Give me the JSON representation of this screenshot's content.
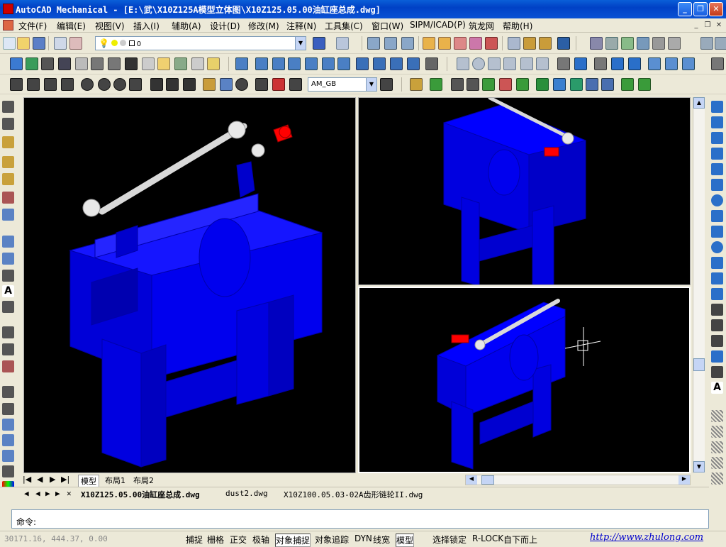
{
  "window": {
    "title": "AutoCAD Mechanical - [E:\\武\\X10Z125A模型立体图\\X10Z125.05.00油缸座总成.dwg]"
  },
  "menu": [
    "文件(F)",
    "编辑(E)",
    "视图(V)",
    "插入(I)",
    "辅助(A)",
    "设计(D)",
    "修改(M)",
    "注释(N)",
    "工具集(C)",
    "窗口(W)",
    "SIPM/ICAD(P)",
    "筑龙网",
    "帮助(H)"
  ],
  "toolbar": {
    "layer_value": "0",
    "dimstyle_value": "AM_GB"
  },
  "layout_tabs": [
    "模型",
    "布局1",
    "布局2"
  ],
  "doc_tabs": [
    "X10Z125.05.00油缸座总成.dwg",
    "dust2.dwg",
    "X10Z100.05.03-02A齿形链轮II.dwg"
  ],
  "command": {
    "prompt": "命令:"
  },
  "status": {
    "coords": "30171.16, 444.37, 0.00",
    "toggles": [
      "捕捉",
      "栅格",
      "正交",
      "极轴",
      "对象捕捉",
      "对象追踪",
      "DYN",
      "线宽",
      "模型",
      "选择锁定",
      "R-LOCK",
      "自下而上"
    ],
    "url": "http://www.zhulong.com"
  },
  "colors": {
    "model": "#0000ff",
    "accent": "#ff0000",
    "shaft": "#e0e0e0",
    "viewport_bg": "#000000"
  }
}
